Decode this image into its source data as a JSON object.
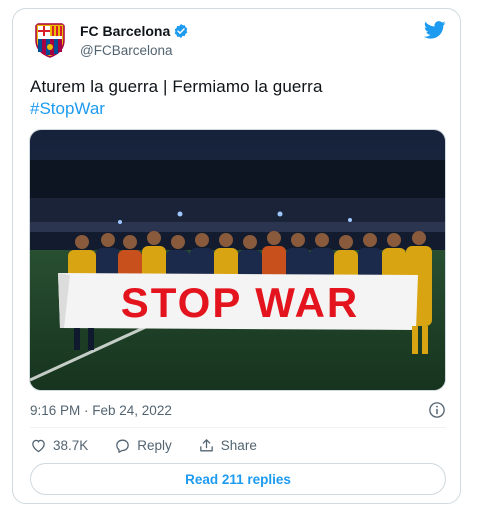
{
  "tweet": {
    "author_name": "FC Barcelona",
    "author_handle": "@FCBarcelona",
    "text_line1": "Aturem la guerra | Fermiamo la guerra",
    "hashtag": "#StopWar",
    "banner_text": "STOP WAR",
    "timestamp": "9:16 PM · Feb 24, 2022",
    "likes_count": "38.7K",
    "reply_label": "Reply",
    "share_label": "Share",
    "read_replies_label": "Read 211 replies"
  },
  "colors": {
    "accent": "#1d9bf0",
    "secondary_text": "#536471",
    "banner_text": "#e3141d",
    "pitch": "#23462c"
  },
  "icons": {
    "verified": "verified-badge-icon",
    "bird": "twitter-bird-icon",
    "info": "info-icon",
    "like": "heart-icon",
    "reply": "reply-bubble-icon",
    "share": "share-icon"
  }
}
